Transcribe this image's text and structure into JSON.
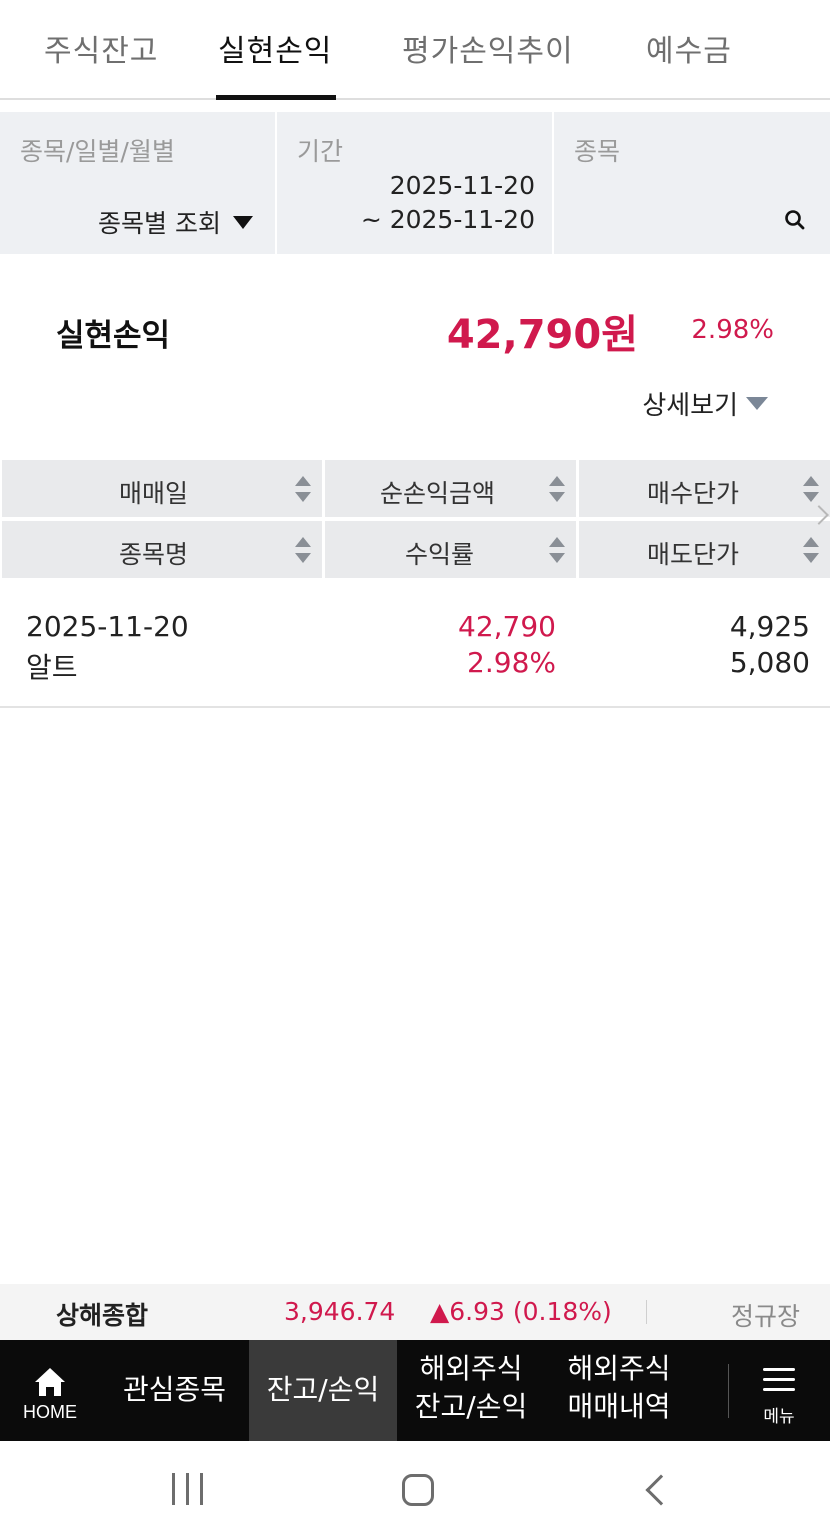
{
  "tabs": [
    {
      "label": "주식잔고"
    },
    {
      "label": "실현손익"
    },
    {
      "label": "평가손익추이"
    },
    {
      "label": "예수금"
    }
  ],
  "active_tab": "실현손익",
  "filters": {
    "type_label": "종목/일별/월별",
    "type_value": "종목별 조회",
    "period_label": "기간",
    "period_start": "2025-11-20",
    "period_end": "~ 2025-11-20",
    "stock_label": "종목",
    "stock_icon": "search-icon"
  },
  "summary": {
    "label": "실현손익",
    "amount": "42,790원",
    "rate": "2.98%",
    "detail_label": "상세보기"
  },
  "table": {
    "header_row1": [
      "매매일",
      "순손익금액",
      "매수단가"
    ],
    "header_row2": [
      "종목명",
      "수익률",
      "매도단가"
    ],
    "rows": [
      {
        "date": "2025-11-20",
        "name": "알트",
        "net_profit": "42,790",
        "rate": "2.98%",
        "buy_price": "4,925",
        "sell_price": "5,080"
      }
    ]
  },
  "ticker": {
    "name": "상해종합",
    "value": "3,946.74",
    "change": "▲6.93 (0.18%)",
    "status": "정규장"
  },
  "bottom_nav": {
    "home_label": "HOME",
    "items": [
      {
        "label1": "관심종목",
        "label2": ""
      },
      {
        "label1": "잔고/손익",
        "label2": ""
      },
      {
        "label1": "해외주식",
        "label2": "잔고/손익"
      },
      {
        "label1": "해외주식",
        "label2": "매매내역"
      }
    ],
    "menu_label": "메뉴"
  },
  "colors": {
    "profit_red": "#d0194d",
    "header_bg": "#e9eaec",
    "filter_bg": "#eef0f3",
    "nav_bg": "#0b0b0b"
  }
}
